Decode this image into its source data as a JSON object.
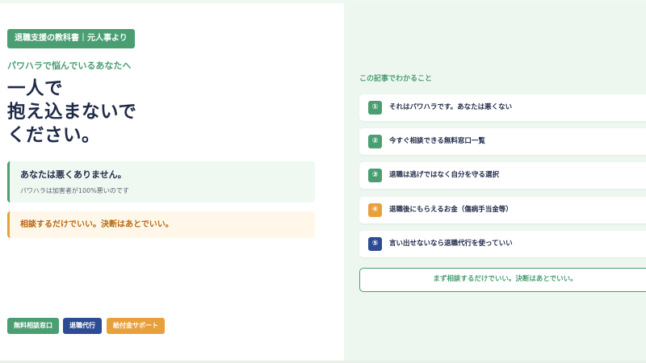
{
  "brand": {
    "label": "退職支援の教科書｜元人事より",
    "color": "#4a9e72"
  },
  "hero": {
    "kicker": "パワハラで悩んでいるあなたへ",
    "headline_lines": [
      "一人で",
      "抱え込まないで",
      "ください。"
    ]
  },
  "notices": [
    {
      "title": "あなたは悪くありません。",
      "subtitle": "パワハラは加害者が100%悪いのです",
      "color": "#4a9e72"
    },
    {
      "title": "相談するだけでいい。決断はあとでいい。",
      "color": "#e8a03a"
    }
  ],
  "tags": [
    {
      "label": "無料相談窓口",
      "color": "#4a9e72"
    },
    {
      "label": "退職代行",
      "color": "#2d4c93"
    },
    {
      "label": "給付金サポート",
      "color": "#e8a03a"
    }
  ],
  "toc": {
    "heading": "この記事でわかること",
    "items": [
      {
        "num": "①",
        "label": "それはパワハラです。あなたは悪くない",
        "color": "#4a9e72"
      },
      {
        "num": "②",
        "label": "今すぐ相談できる無料窓口一覧",
        "color": "#4a9e72"
      },
      {
        "num": "③",
        "label": "退職は逃げではなく自分を守る選択",
        "color": "#4a9e72"
      },
      {
        "num": "④",
        "label": "退職後にもらえるお金（傷病手当金等）",
        "color": "#e8a03a"
      },
      {
        "num": "⑤",
        "label": "言い出せないなら退職代行を使っていい",
        "color": "#2d4c93"
      }
    ],
    "cta_label": "まず相談するだけでいい。決断はあとでいい。"
  }
}
